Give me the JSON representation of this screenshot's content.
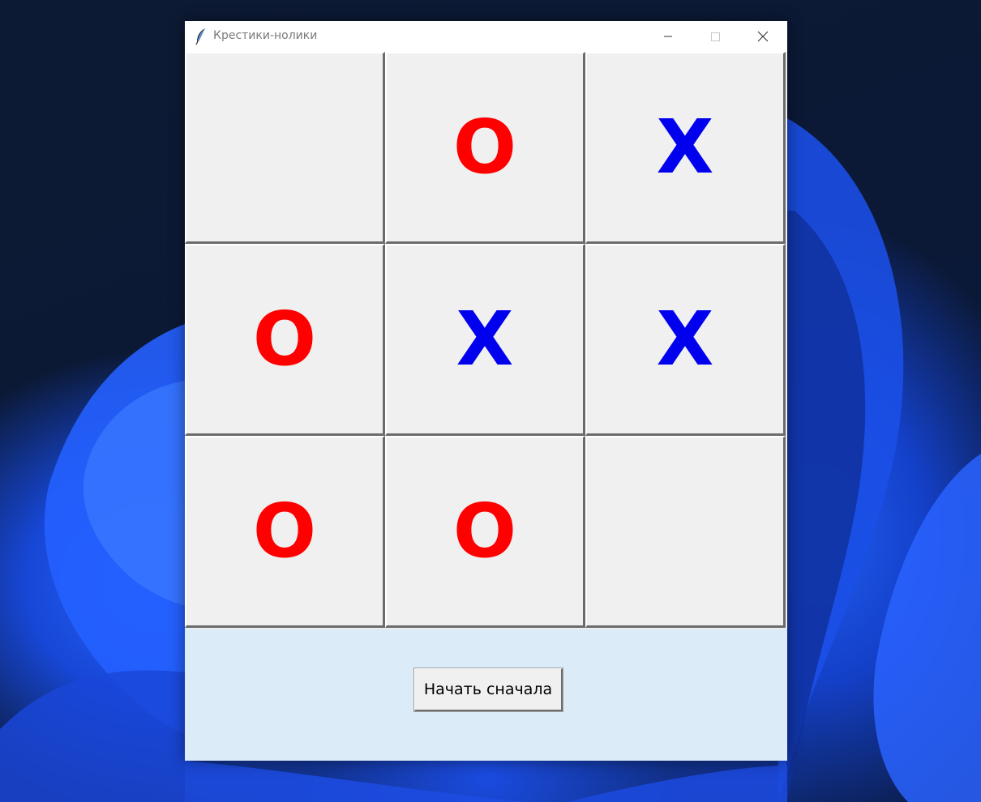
{
  "window": {
    "title": "Крестики-нолики",
    "app_icon": "feather-icon",
    "controls": {
      "minimize_icon": "minimize-icon",
      "maximize_icon": "maximize-icon",
      "close_icon": "close-icon"
    }
  },
  "board": {
    "cells": [
      "",
      "O",
      "X",
      "O",
      "X",
      "X",
      "O",
      "O",
      ""
    ],
    "colors": {
      "O": "#ff0000",
      "X": "#0000ee"
    }
  },
  "footer": {
    "restart_label": "Начать сначала"
  },
  "colors": {
    "board_background": "#f0f0f0",
    "footer_background": "#dbebf8"
  }
}
